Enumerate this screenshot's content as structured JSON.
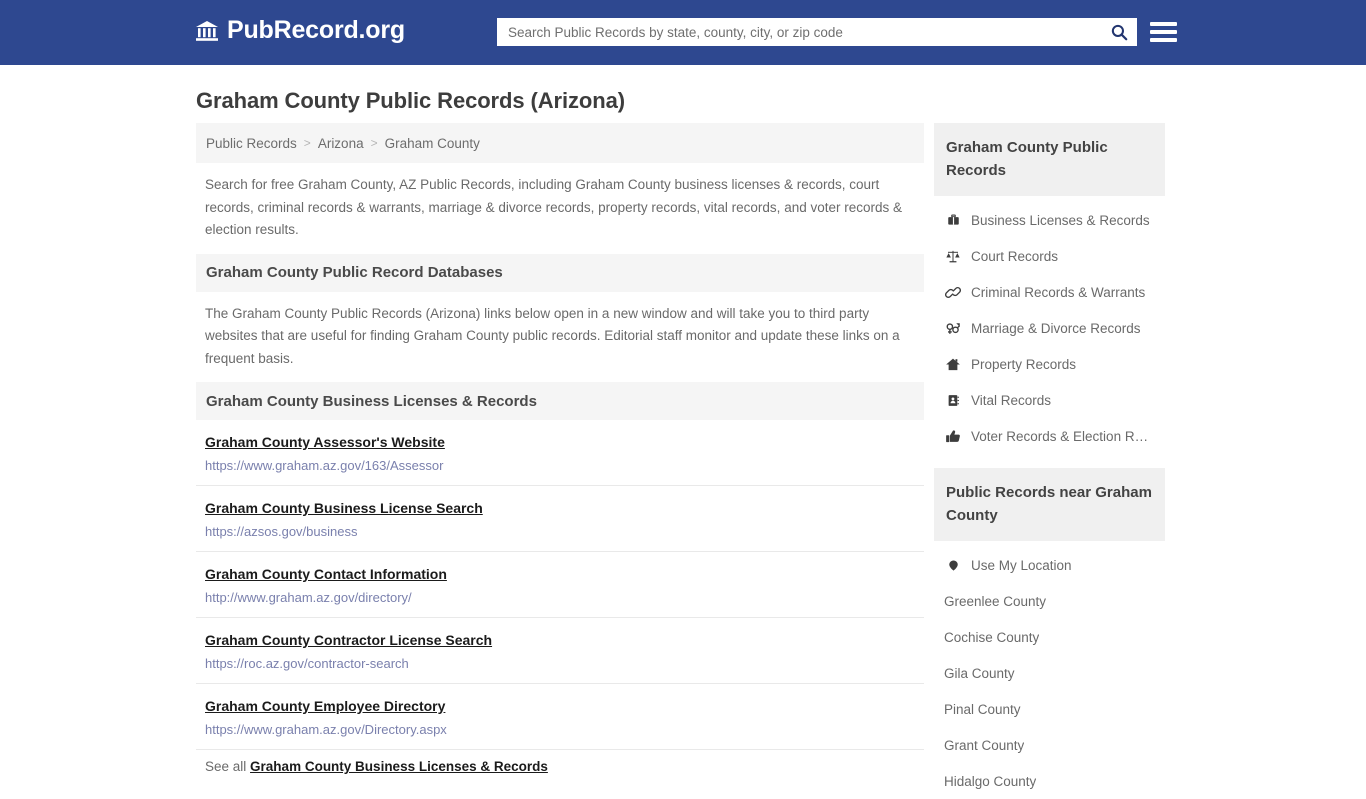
{
  "header": {
    "brand_name": "PubRecord.org",
    "brand_icon": "bank-icon",
    "search_placeholder": "Search Public Records by state, county, city, or zip code",
    "search_value": "",
    "search_icon": "search-icon",
    "menu_icon": "hamburger-menu-icon",
    "background_color": "#2e4890"
  },
  "page": {
    "title": "Graham County Public Records (Arizona)"
  },
  "breadcrumb": {
    "items": [
      {
        "label": "Public Records"
      },
      {
        "label": "Arizona"
      },
      {
        "label": "Graham County"
      }
    ],
    "separator": ">"
  },
  "intro": {
    "text": "Search for free Graham County, AZ Public Records, including Graham County business licenses & records, court records, criminal records & warrants, marriage & divorce records, property records, vital records, and voter records & election results."
  },
  "databases_section": {
    "heading": "Graham County Public Record Databases",
    "text": "The Graham County Public Records (Arizona) links below open in a new window and will take you to third party websites that are useful for finding Graham County public records. Editorial staff monitor and update these links on a frequent basis."
  },
  "business_section": {
    "heading": "Graham County Business Licenses & Records",
    "links": [
      {
        "title": "Graham County Assessor's Website",
        "url": "https://www.graham.az.gov/163/Assessor"
      },
      {
        "title": "Graham County Business License Search",
        "url": "https://azsos.gov/business"
      },
      {
        "title": "Graham County Contact Information",
        "url": "http://www.graham.az.gov/directory/"
      },
      {
        "title": "Graham County Contractor License Search",
        "url": "https://roc.az.gov/contractor-search"
      },
      {
        "title": "Graham County Employee Directory",
        "url": "https://www.graham.az.gov/Directory.aspx"
      }
    ],
    "see_all_prefix": "See all",
    "see_all_link": "Graham County Business Licenses & Records"
  },
  "sidebar": {
    "records_panel": {
      "heading": "Graham County Public Records",
      "items": [
        {
          "label": "Business Licenses & Records",
          "icon": "briefcase-icon"
        },
        {
          "label": "Court Records",
          "icon": "scales-of-justice-icon"
        },
        {
          "label": "Criminal Records & Warrants",
          "icon": "handcuffs-icon"
        },
        {
          "label": "Marriage & Divorce Records",
          "icon": "venus-mars-icon"
        },
        {
          "label": "Property Records",
          "icon": "home-icon"
        },
        {
          "label": "Vital Records",
          "icon": "address-book-icon"
        },
        {
          "label": "Voter Records & Election R…",
          "icon": "thumbs-up-icon"
        }
      ]
    },
    "nearby_panel": {
      "heading": "Public Records near Graham County",
      "items": [
        {
          "label": "Use My Location",
          "icon": "map-pin-icon"
        },
        {
          "label": "Greenlee County",
          "icon": ""
        },
        {
          "label": "Cochise County",
          "icon": ""
        },
        {
          "label": "Gila County",
          "icon": ""
        },
        {
          "label": "Pinal County",
          "icon": ""
        },
        {
          "label": "Grant County",
          "icon": ""
        },
        {
          "label": "Hidalgo County",
          "icon": ""
        }
      ]
    }
  }
}
